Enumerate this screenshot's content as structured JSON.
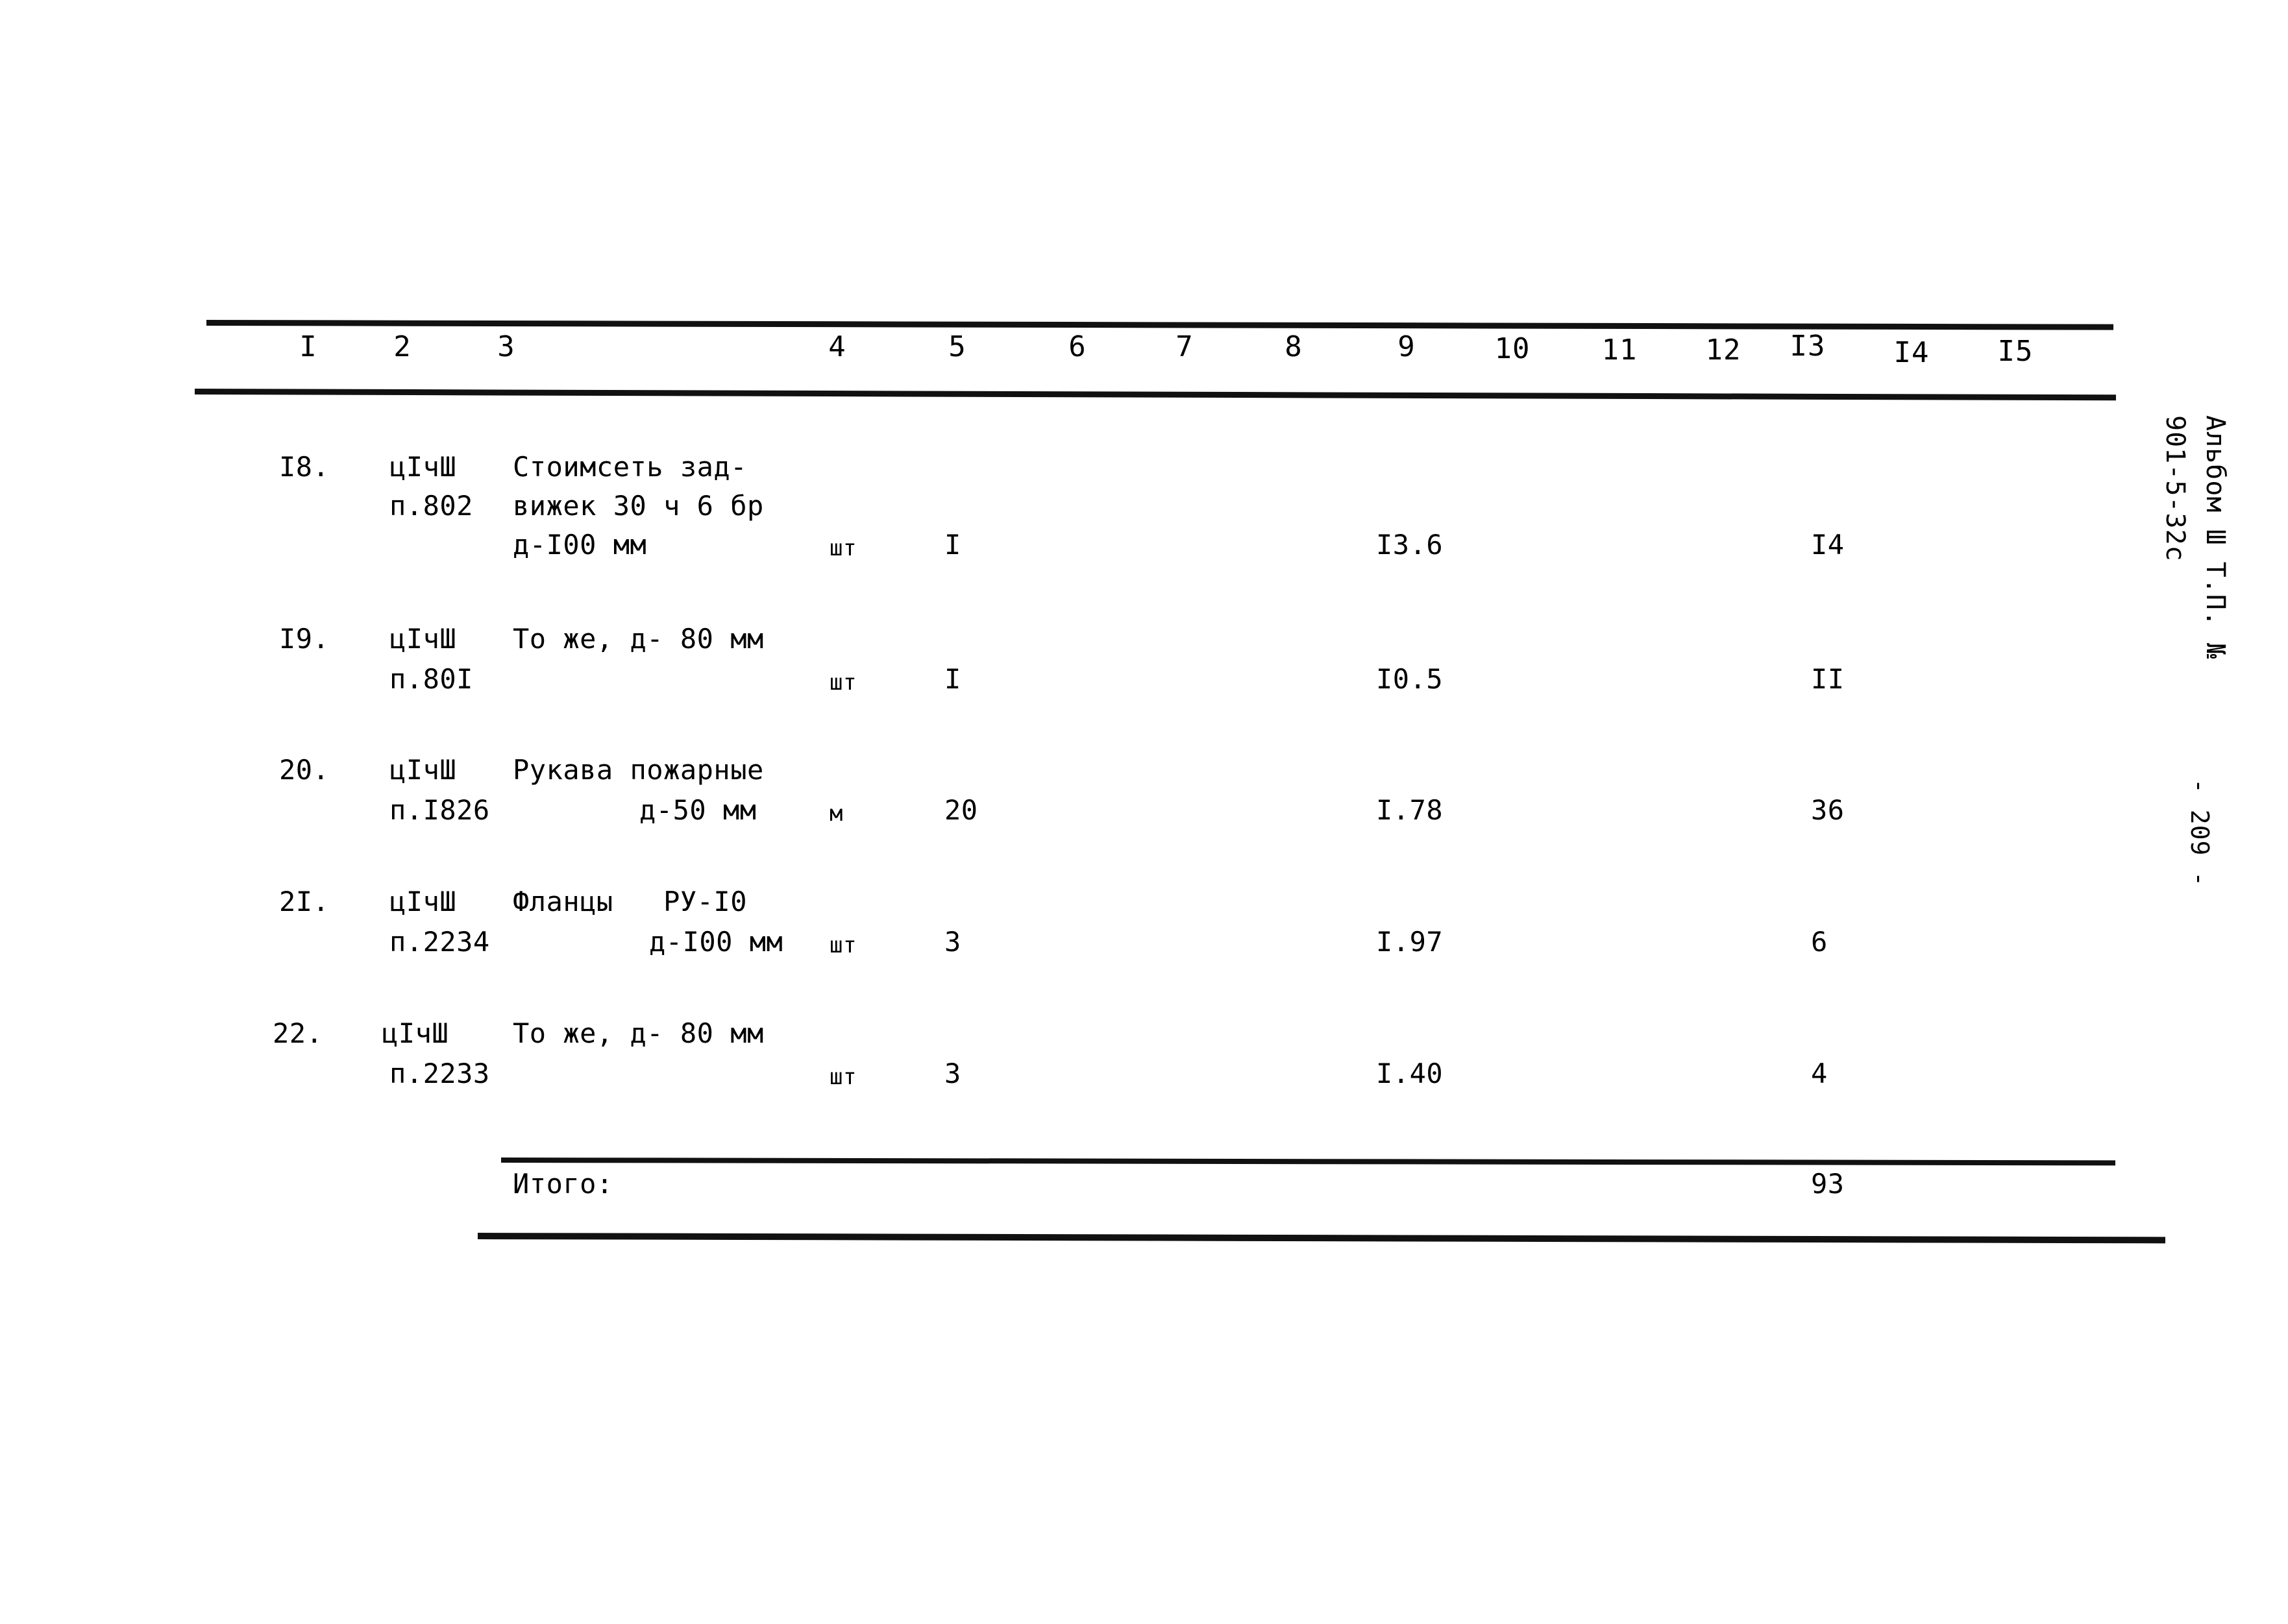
{
  "document": {
    "type": "scanned-estimate-table",
    "margin_note_line1": "Альбом Ш Т.П. №",
    "margin_note_line2": "901-5-32с",
    "page_marker": "- 209 -"
  },
  "table": {
    "column_headers": [
      "I",
      "2",
      "3",
      "4",
      "5",
      "6",
      "7",
      "8",
      "9",
      "10",
      "11",
      "12",
      "I3",
      "I4",
      "I5"
    ],
    "rows": [
      {
        "num": "I8.",
        "ref_line1": "цIчШ",
        "ref_line2": "п.802",
        "desc_line1": "Стоимсеть зад-",
        "desc_line2": "вижек 30 ч 6 бр",
        "desc_line3": "д-I00 мм",
        "unit": "шт",
        "qty": "I",
        "price": "I3.6",
        "sum": "I4"
      },
      {
        "num": "I9.",
        "ref_line1": "цIчШ",
        "ref_line2": "п.80I",
        "desc_line1": "То же, д- 80 мм",
        "desc_line2": "",
        "desc_line3": "",
        "unit": "шт",
        "qty": "I",
        "price": "I0.5",
        "sum": "II"
      },
      {
        "num": "20.",
        "ref_line1": "цIчШ",
        "ref_line2": "п.I826",
        "desc_line1": "Рукава пожарные",
        "desc_line2": "д-50 мм",
        "desc_line3": "",
        "unit": "м",
        "qty": "20",
        "price": "I.78",
        "sum": "36"
      },
      {
        "num": "2I.",
        "ref_line1": "цIчШ",
        "ref_line2": "п.2234",
        "desc_line1": "Фланцы   РУ-I0",
        "desc_line2": "д-I00 мм",
        "desc_line3": "",
        "unit": "шт",
        "qty": "3",
        "price": "I.97",
        "sum": "6"
      },
      {
        "num": "22.",
        "ref_line1": "цIчШ",
        "ref_line2": "п.2233",
        "desc_line1": "То же, д- 80 мм",
        "desc_line2": "",
        "desc_line3": "",
        "unit": "шт",
        "qty": "3",
        "price": "I.40",
        "sum": "4"
      }
    ],
    "total": {
      "label": "Итого:",
      "value": "93"
    }
  }
}
